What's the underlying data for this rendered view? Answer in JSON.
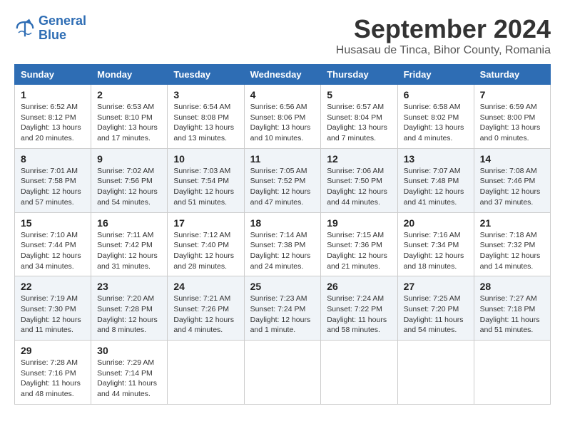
{
  "logo": {
    "line1": "General",
    "line2": "Blue"
  },
  "title": "September 2024",
  "subtitle": "Husasau de Tinca, Bihor County, Romania",
  "days_of_week": [
    "Sunday",
    "Monday",
    "Tuesday",
    "Wednesday",
    "Thursday",
    "Friday",
    "Saturday"
  ],
  "weeks": [
    [
      {
        "day": "1",
        "info": "Sunrise: 6:52 AM\nSunset: 8:12 PM\nDaylight: 13 hours and 20 minutes."
      },
      {
        "day": "2",
        "info": "Sunrise: 6:53 AM\nSunset: 8:10 PM\nDaylight: 13 hours and 17 minutes."
      },
      {
        "day": "3",
        "info": "Sunrise: 6:54 AM\nSunset: 8:08 PM\nDaylight: 13 hours and 13 minutes."
      },
      {
        "day": "4",
        "info": "Sunrise: 6:56 AM\nSunset: 8:06 PM\nDaylight: 13 hours and 10 minutes."
      },
      {
        "day": "5",
        "info": "Sunrise: 6:57 AM\nSunset: 8:04 PM\nDaylight: 13 hours and 7 minutes."
      },
      {
        "day": "6",
        "info": "Sunrise: 6:58 AM\nSunset: 8:02 PM\nDaylight: 13 hours and 4 minutes."
      },
      {
        "day": "7",
        "info": "Sunrise: 6:59 AM\nSunset: 8:00 PM\nDaylight: 13 hours and 0 minutes."
      }
    ],
    [
      {
        "day": "8",
        "info": "Sunrise: 7:01 AM\nSunset: 7:58 PM\nDaylight: 12 hours and 57 minutes."
      },
      {
        "day": "9",
        "info": "Sunrise: 7:02 AM\nSunset: 7:56 PM\nDaylight: 12 hours and 54 minutes."
      },
      {
        "day": "10",
        "info": "Sunrise: 7:03 AM\nSunset: 7:54 PM\nDaylight: 12 hours and 51 minutes."
      },
      {
        "day": "11",
        "info": "Sunrise: 7:05 AM\nSunset: 7:52 PM\nDaylight: 12 hours and 47 minutes."
      },
      {
        "day": "12",
        "info": "Sunrise: 7:06 AM\nSunset: 7:50 PM\nDaylight: 12 hours and 44 minutes."
      },
      {
        "day": "13",
        "info": "Sunrise: 7:07 AM\nSunset: 7:48 PM\nDaylight: 12 hours and 41 minutes."
      },
      {
        "day": "14",
        "info": "Sunrise: 7:08 AM\nSunset: 7:46 PM\nDaylight: 12 hours and 37 minutes."
      }
    ],
    [
      {
        "day": "15",
        "info": "Sunrise: 7:10 AM\nSunset: 7:44 PM\nDaylight: 12 hours and 34 minutes."
      },
      {
        "day": "16",
        "info": "Sunrise: 7:11 AM\nSunset: 7:42 PM\nDaylight: 12 hours and 31 minutes."
      },
      {
        "day": "17",
        "info": "Sunrise: 7:12 AM\nSunset: 7:40 PM\nDaylight: 12 hours and 28 minutes."
      },
      {
        "day": "18",
        "info": "Sunrise: 7:14 AM\nSunset: 7:38 PM\nDaylight: 12 hours and 24 minutes."
      },
      {
        "day": "19",
        "info": "Sunrise: 7:15 AM\nSunset: 7:36 PM\nDaylight: 12 hours and 21 minutes."
      },
      {
        "day": "20",
        "info": "Sunrise: 7:16 AM\nSunset: 7:34 PM\nDaylight: 12 hours and 18 minutes."
      },
      {
        "day": "21",
        "info": "Sunrise: 7:18 AM\nSunset: 7:32 PM\nDaylight: 12 hours and 14 minutes."
      }
    ],
    [
      {
        "day": "22",
        "info": "Sunrise: 7:19 AM\nSunset: 7:30 PM\nDaylight: 12 hours and 11 minutes."
      },
      {
        "day": "23",
        "info": "Sunrise: 7:20 AM\nSunset: 7:28 PM\nDaylight: 12 hours and 8 minutes."
      },
      {
        "day": "24",
        "info": "Sunrise: 7:21 AM\nSunset: 7:26 PM\nDaylight: 12 hours and 4 minutes."
      },
      {
        "day": "25",
        "info": "Sunrise: 7:23 AM\nSunset: 7:24 PM\nDaylight: 12 hours and 1 minute."
      },
      {
        "day": "26",
        "info": "Sunrise: 7:24 AM\nSunset: 7:22 PM\nDaylight: 11 hours and 58 minutes."
      },
      {
        "day": "27",
        "info": "Sunrise: 7:25 AM\nSunset: 7:20 PM\nDaylight: 11 hours and 54 minutes."
      },
      {
        "day": "28",
        "info": "Sunrise: 7:27 AM\nSunset: 7:18 PM\nDaylight: 11 hours and 51 minutes."
      }
    ],
    [
      {
        "day": "29",
        "info": "Sunrise: 7:28 AM\nSunset: 7:16 PM\nDaylight: 11 hours and 48 minutes."
      },
      {
        "day": "30",
        "info": "Sunrise: 7:29 AM\nSunset: 7:14 PM\nDaylight: 11 hours and 44 minutes."
      },
      null,
      null,
      null,
      null,
      null
    ]
  ]
}
